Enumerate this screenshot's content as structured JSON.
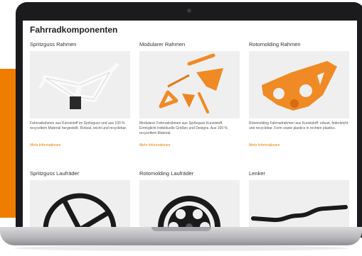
{
  "page": {
    "title": "Fahrradkomponenten"
  },
  "colors": {
    "accent": "#ef7d00",
    "frame_orange": "#f08a24",
    "frame_white": "#f4f4f4",
    "wheel_black": "#1a1a1a"
  },
  "row1": [
    {
      "title": "Spritzguss Rahmen",
      "image_icon": "white-ebike-frame-image",
      "desc": "Fahrradrahmen aus Kunststoff im Spritzguss und aus 100 % recyceltem Material hergestellt. Robust, leicht und recyclebar.",
      "link": "Mehr Informationen"
    },
    {
      "title": "Modularer Rahmen",
      "image_icon": "modular-frame-parts-image",
      "desc": "Modularer Fahrradrahmen aus Spritzguss Kunststoff. Ermöglicht individuelle Größen und Designs. Aus 100 % recyceltem Material.",
      "link": "Mehr Informationen"
    },
    {
      "title": "Rotomolding Rahmen",
      "image_icon": "orange-frame-image",
      "desc": "Rotomolding Fahrradrahmen aus Kunststoff: robust, federleicht und recyclebar. Form sowie plastics in rechten plastics.",
      "link": "Mehr Informationen"
    }
  ],
  "row2": [
    {
      "title": "Spritzguss Laufräder",
      "image_icon": "spoked-wheel-image"
    },
    {
      "title": "Rotomolding Laufräder",
      "image_icon": "molded-wheel-image"
    },
    {
      "title": "Lenker",
      "image_icon": "handlebar-image"
    }
  ]
}
